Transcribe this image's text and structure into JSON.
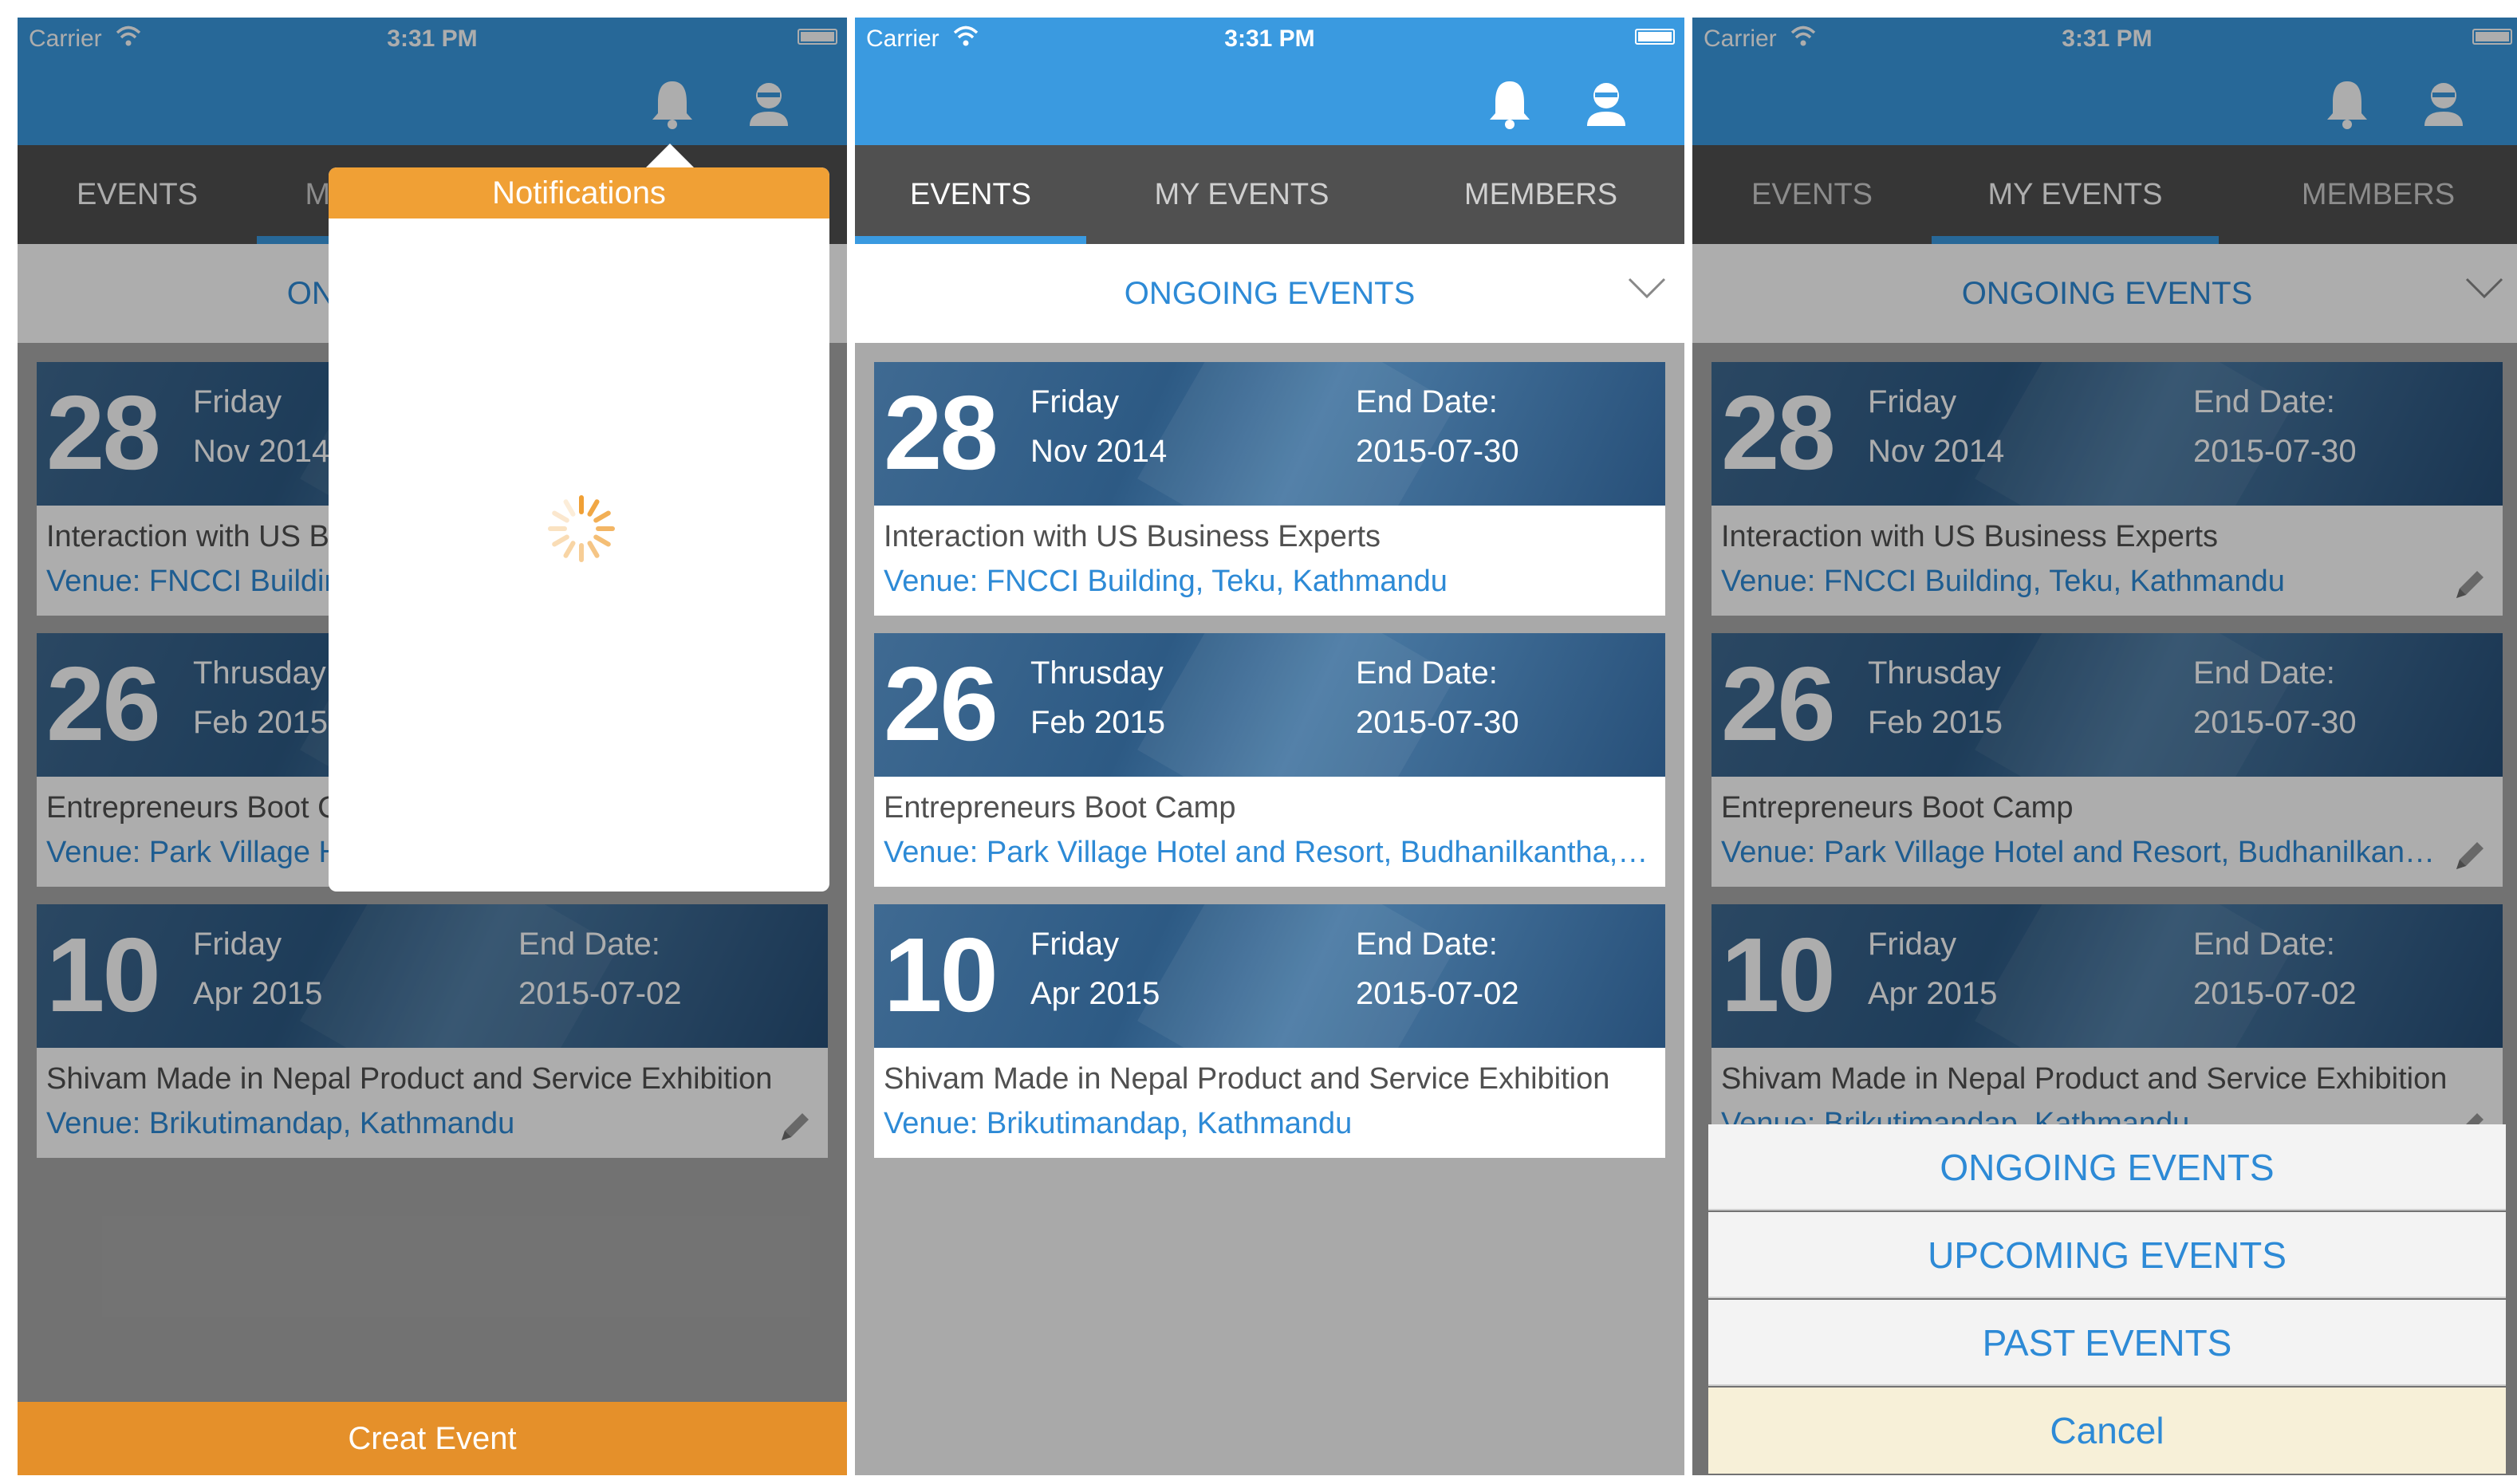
{
  "status": {
    "carrier": "Carrier",
    "time": "3:31 PM"
  },
  "tabs": [
    "EVENTS",
    "MY EVENTS",
    "MEMBERS"
  ],
  "filter": {
    "label": "ONGOING EVENTS"
  },
  "events": [
    {
      "day": "28",
      "weekday": "Friday",
      "month_year": "Nov 2014",
      "end_label": "End Date:",
      "end_date": "2015-07-30",
      "title": "Interaction with US Business Experts",
      "venue": "Venue: FNCCI Building, Teku, Kathmandu"
    },
    {
      "day": "26",
      "weekday": "Thrusday",
      "month_year": "Feb 2015",
      "end_label": "End Date:",
      "end_date": "2015-07-30",
      "title": "Entrepreneurs Boot Camp",
      "venue": "Venue: Park Village Hotel and Resort, Budhanilkantha, Kathmandu"
    },
    {
      "day": "10",
      "weekday": "Friday",
      "month_year": "Apr 2015",
      "end_label": "End Date:",
      "end_date": "2015-07-02",
      "title": "Shivam Made in Nepal Product and Service Exhibition",
      "venue": "Venue: Brikutimandap, Kathmandu"
    }
  ],
  "screen1": {
    "popover_title": "Notifications",
    "create_button": "Creat Event"
  },
  "screen3": {
    "sheet_options": [
      "ONGOING EVENTS",
      "UPCOMING EVENTS",
      "PAST EVENTS"
    ],
    "cancel": "Cancel"
  },
  "colors": {
    "nav": "#3a9ae0",
    "accent_blue": "#2d8ad6",
    "orange": "#f0a035",
    "tabbar": "#505050"
  },
  "icons": [
    "wifi-icon",
    "battery-icon",
    "bell-icon",
    "user-icon",
    "chevron-down-icon",
    "pencil-icon",
    "spinner-icon"
  ]
}
